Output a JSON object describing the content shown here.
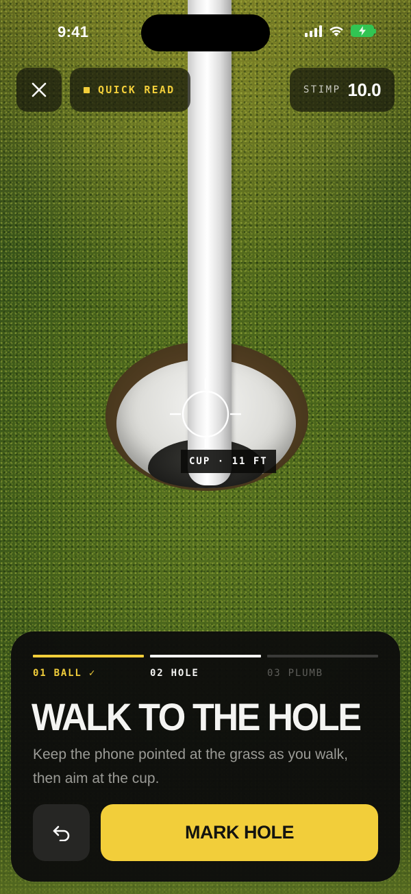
{
  "status_bar": {
    "time": "9:41",
    "icons": [
      "cellular-signal-icon",
      "wifi-icon",
      "battery-charging-icon"
    ]
  },
  "top_bar": {
    "close_icon": "close-icon",
    "mode_label": "QUICK READ",
    "stimp_label": "STIMP",
    "stimp_value": "10.0"
  },
  "target": {
    "reticle_icon": "crosshair-reticle-icon",
    "tag": "CUP · 11 FT"
  },
  "sheet": {
    "steps": [
      {
        "label": "01 BALL ✓",
        "state": "complete"
      },
      {
        "label": "02 HOLE",
        "state": "active"
      },
      {
        "label": "03 PLUMB",
        "state": "pending"
      }
    ],
    "title": "WALK TO THE HOLE",
    "body": "Keep the phone pointed at the grass as you walk, then aim at the cup.",
    "back_icon": "undo-arrow-icon",
    "primary_label": "MARK HOLE"
  },
  "colors": {
    "accent": "#f2ce3a",
    "sheet_bg": "#0e0e0c",
    "text_primary": "#f4f4f2",
    "text_secondary": "#9b9b96",
    "battery": "#31c553"
  }
}
